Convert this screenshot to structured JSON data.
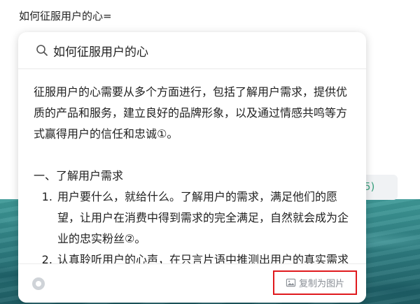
{
  "query_line": "如何征服用户的心=",
  "background": {
    "input_text": "5)"
  },
  "card": {
    "search_text": "如何征服用户的心",
    "intro": "征服用户的心需要从多个方面进行，包括了解用户需求，提供优质的产品和服务，建立良好的品牌形象，以及通过情感共鸣等方式赢得用户的信任和忠诚①。",
    "section_heading": "一、了解用户需求",
    "list_items": [
      "用户要什么，就给什么。了解用户的需求，满足他们的愿望，让用户在消费中得到需求的完全满足，自然就会成为企业的忠实粉丝②。",
      "认真聆听用户的心声，在只言片语中推测出用户的真实需求"
    ],
    "copy_button_label": "复制为图片"
  },
  "colors": {
    "highlight_border": "#e0191d",
    "sea": "#2f7f83",
    "accent_green": "#3aa17e"
  },
  "icons": [
    "search-icon",
    "brand-logo-icon",
    "image-icon"
  ]
}
